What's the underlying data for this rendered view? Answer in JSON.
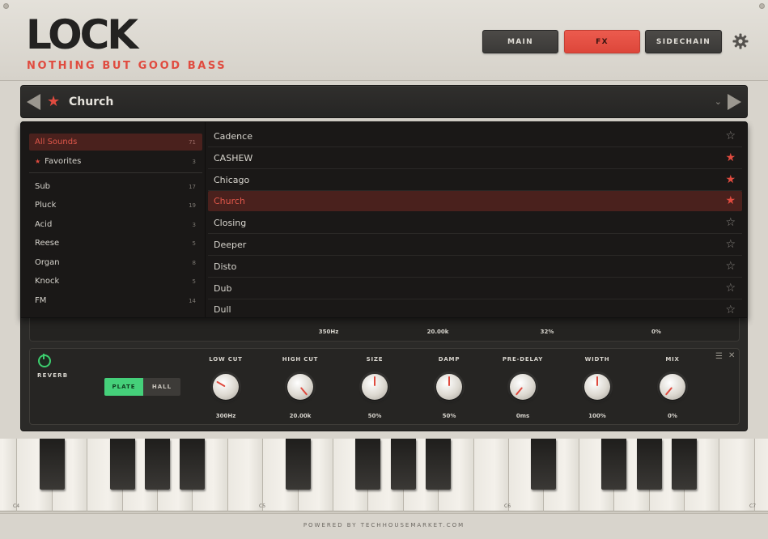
{
  "header": {
    "logo": "LOCK",
    "tagline": "NOTHING BUT GOOD BASS",
    "tabs": [
      {
        "label": "MAIN",
        "active": false
      },
      {
        "label": "FX",
        "active": true
      },
      {
        "label": "SIDECHAIN",
        "active": false
      }
    ],
    "settings_icon": "gear-icon"
  },
  "preset_bar": {
    "current": "Church",
    "favorite": true,
    "prev_icon": "triangle-left-icon",
    "next_icon": "triangle-right-icon",
    "dropdown_icon": "chevron-down-icon"
  },
  "browser": {
    "categories": [
      {
        "label": "All Sounds",
        "count": "71",
        "active": true
      },
      {
        "label": "Favorites",
        "count": "3",
        "star": true
      },
      {
        "label": "Sub",
        "count": "17"
      },
      {
        "label": "Pluck",
        "count": "19"
      },
      {
        "label": "Acid",
        "count": "3"
      },
      {
        "label": "Reese",
        "count": "5"
      },
      {
        "label": "Organ",
        "count": "8"
      },
      {
        "label": "Knock",
        "count": "5"
      },
      {
        "label": "FM",
        "count": "14"
      }
    ],
    "presets": [
      {
        "name": "Cadence",
        "favorite": false
      },
      {
        "name": "CASHEW",
        "favorite": true
      },
      {
        "name": "Chicago",
        "favorite": true
      },
      {
        "name": "Church",
        "favorite": true,
        "active": true
      },
      {
        "name": "Closing",
        "favorite": false
      },
      {
        "name": "Deeper",
        "favorite": false
      },
      {
        "name": "Disto",
        "favorite": false
      },
      {
        "name": "Dub",
        "favorite": false
      },
      {
        "name": "Dull",
        "favorite": false
      }
    ]
  },
  "eq_values": [
    "350Hz",
    "20.00k",
    "32%",
    "0%"
  ],
  "reverb": {
    "name": "REVERB",
    "enabled": true,
    "modes": [
      "PLATE",
      "HALL"
    ],
    "selected_mode": "PLATE",
    "knobs": [
      {
        "label": "LOW CUT",
        "value": "300Hz",
        "rotation_deg": -60
      },
      {
        "label": "HIGH CUT",
        "value": "20.00k",
        "rotation_deg": 140
      },
      {
        "label": "SIZE",
        "value": "50%",
        "rotation_deg": 0
      },
      {
        "label": "DAMP",
        "value": "50%",
        "rotation_deg": 0
      },
      {
        "label": "PRE-DELAY",
        "value": "0ms",
        "rotation_deg": -140
      },
      {
        "label": "WIDTH",
        "value": "100%",
        "rotation_deg": 0
      },
      {
        "label": "MIX",
        "value": "0%",
        "rotation_deg": -140
      }
    ]
  },
  "keyboard": {
    "octave_labels": [
      "C4",
      "C5",
      "C6",
      "C7"
    ]
  },
  "footer": {
    "text": "POWERED BY TECHHOUSEMARKET.COM"
  },
  "colors": {
    "accent": "#e04b3f",
    "power_on": "#3ccf6e",
    "panel": "#2b2a28"
  }
}
